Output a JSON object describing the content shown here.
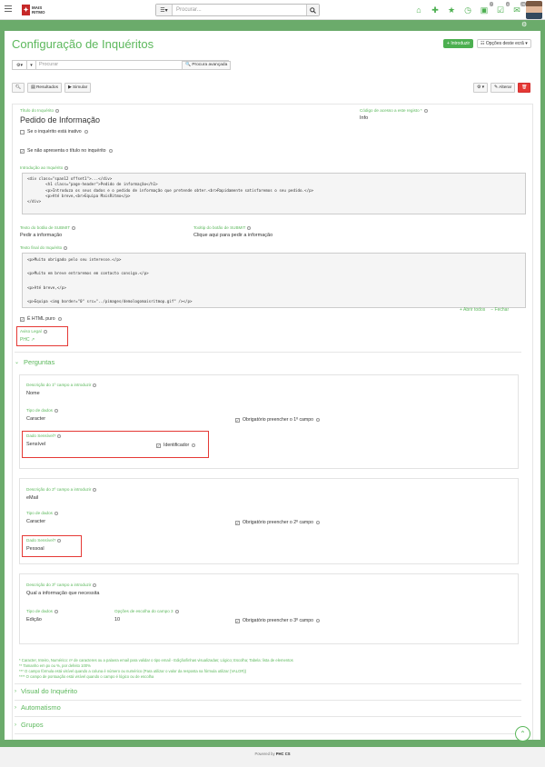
{
  "topbar": {
    "logo_line1": "MAIS",
    "logo_line2": "RITMO",
    "search_placeholder": "Procurar...",
    "badges": [
      "7",
      "4",
      "28"
    ]
  },
  "page": {
    "title": "Configuração de Inquéritos",
    "introduce_button": "Introduzir",
    "options_button": "Opções deste ecrã"
  },
  "searchbar": {
    "placeholder": "Procurar",
    "advanced": "Procura avançada"
  },
  "toolbar": {
    "results": "Resultados",
    "simulate": "Simular",
    "edit": "Alterar"
  },
  "form": {
    "title_label": "Título do Inquérito",
    "title_value": "Pedido de Informação",
    "access_code_label": "Código de acesso a este registo",
    "access_code_value": "Info",
    "inactive_label": "Se o inquérito está inativo",
    "hide_title_label": "Se não apresenta o título no inquérito",
    "intro_label": "Introdução ao Inquérito",
    "intro_code": [
      "<div class=\"span12 offset1\">...</div>",
      "        <h1 class=\"page-header\">Pedido de informação</h1>",
      "        <p>Introduza os seus dados e o pedido de informação que pretende obter.<br>Rapidamente satisfaremos o seu pedido.</p>",
      "        <p>Até breve,<br>Equipa MaisRitmo</p>",
      "</div>"
    ],
    "submit_text_label": "Texto do botão de SUBMIT",
    "submit_text_value": "Pedir a informação",
    "submit_tooltip_label": "Tooltip do botão de SUBMIT",
    "submit_tooltip_value": "Clique aqui para pedir a informação",
    "final_text_label": "Texto final do Inquérito",
    "final_code": [
      "<p>Muito obrigado pelo seu interesse.</p>",
      "",
      "<p>Muito em breve entraremos em contacto consigo.</p>",
      "",
      "<p>Até breve,</p>",
      "",
      "<p>Equipa <img border=\"0\" src=\"../pimages/demologomaisritmop.gif\" /></p>"
    ],
    "html_pure_label": "É HTML puro",
    "legal_notice_label": "Aviso Legal",
    "legal_notice_value": "PHC ↗",
    "open_all": "Abrir todos",
    "close_all": "Fechar"
  },
  "questions": {
    "section_title": "Perguntas",
    "q1": {
      "desc_label": "Descrição do 1º campo a introduzir",
      "desc_value": "Nome",
      "type_label": "Tipo de dados",
      "type_value": "Caracter",
      "required_label": "Obrigatório preencher o 1º campo",
      "sensitive_label": "Dado Sensível?",
      "sensitive_value": "Sensível",
      "identifier_label": "Identificador"
    },
    "q2": {
      "desc_label": "Descrição do 2º campo a introduzir",
      "desc_value": "eMail",
      "type_label": "Tipo de dados",
      "type_value": "Caracter",
      "required_label": "Obrigatório preencher o 2º campo",
      "sensitive_label": "Dado Sensível?",
      "sensitive_value": "Pessoal"
    },
    "q3": {
      "desc_label": "Descrição do 3º campo a introduzir",
      "desc_value": "Qual a informação que necessita",
      "type_label": "Tipo de dados",
      "type_value": "Edição",
      "options_label": "Opções de escolha do campo 3",
      "options_value": "10",
      "required_label": "Obrigatório preencher o 3º campo"
    }
  },
  "notes": [
    "* Caracter, Inteiro, Numérico: nº de caracteres ou a palavra email para validar o tipo email - Edição/linhas visualizadas; Lógico; Escolha; Tabela: lista de elementos",
    "** Tamanho em px ou %, por defeito 100%",
    "*** O campo fórmula está visível quando a coluna é número ou numérico (Para utilizar o valor da resposta na fórmula utilizar {VALOR})",
    "**** O campo de pontuação está visível quando o campo é lógico ou de escolha"
  ],
  "sections": [
    "Visual do Inquérito",
    "Automatismo",
    "Grupos"
  ],
  "footer": {
    "powered": "Powered by",
    "brand": "PHC CS"
  }
}
